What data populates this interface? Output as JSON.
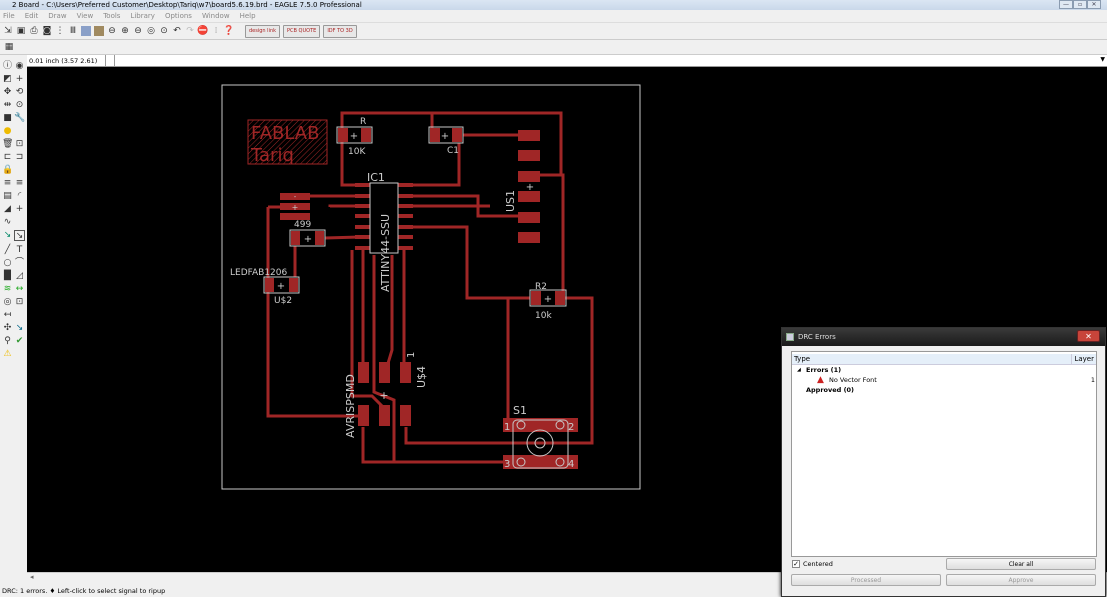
{
  "window": {
    "title": "2 Board - C:\\Users\\Preferred Customer\\Desktop\\Tariq\\w7\\board5.6.19.brd - EAGLE 7.5.0 Professional",
    "controls": [
      "—",
      "▫",
      "✕"
    ]
  },
  "menu": [
    "File",
    "Edit",
    "Draw",
    "View",
    "Tools",
    "Library",
    "Options",
    "Window",
    "Help"
  ],
  "toolbar": {
    "buttons": [
      "open-icon",
      "save-icon",
      "print-icon",
      "cam-icon",
      "script-icon",
      "ulp-icon",
      "sch-icon",
      "brd-icon",
      "zoom-fit-icon",
      "zoom-in-icon",
      "zoom-out-icon",
      "zoom-redraw-icon",
      "zoom-select-icon",
      "undo-icon",
      "redo-icon",
      "stop-icon",
      "go-icon",
      "help-icon"
    ],
    "extras": [
      "design link",
      "PCB QUOTE",
      "IDF TO 3D"
    ]
  },
  "coordinates": "0.01 inch (3.57 2.61)",
  "board": {
    "logo": [
      "FABLAB",
      "Tariq"
    ],
    "labels": {
      "r": "R",
      "r_value": "10K",
      "c1": "C1",
      "ic1": "IC1",
      "ic1_value": "ATTINY44-SSU",
      "us1": "US1",
      "r499": "499",
      "led": "LEDFAB1206",
      "us2": "U$2",
      "r2": "R2",
      "r2_value": "10k",
      "s1": "S1",
      "avrisp": "AVRISPSMD",
      "us4": "U$4",
      "pin1": "1",
      "s1_pins": [
        "1",
        "2",
        "3",
        "4"
      ],
      "minus": "-",
      "plus": "+"
    },
    "colors": {
      "copper": "#a02626",
      "outline": "#c8c8c8",
      "silk": "#c8c8c8",
      "background": "#000000"
    }
  },
  "drc_dialog": {
    "title": "DRC Errors",
    "columns": {
      "type": "Type",
      "layer": "Layer"
    },
    "errors_group": "Errors (1)",
    "errors": [
      {
        "type": "No Vector Font",
        "layer": "1",
        "icon": "warning-icon"
      }
    ],
    "approved_group": "Approved (0)",
    "centered_label": "Centered",
    "centered_checked": true,
    "clear_all": "Clear all",
    "processed": "Processed",
    "approve": "Approve"
  },
  "status": "DRC: 1 errors.  ♦ Left-click to select signal to ripup"
}
